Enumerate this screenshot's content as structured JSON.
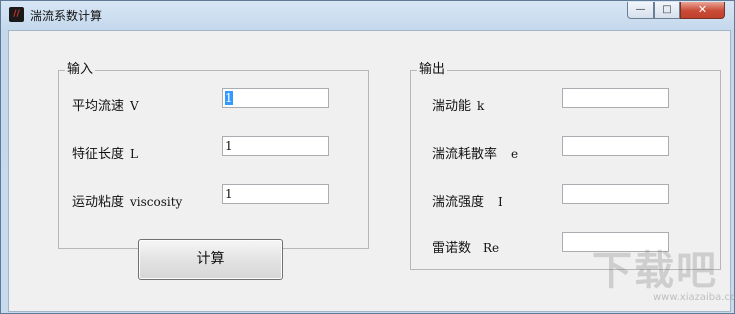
{
  "window": {
    "title": "湍流系数计算",
    "icon": "app-icon",
    "controls": {
      "minimize": "—",
      "maximize": "□",
      "close": "✕"
    }
  },
  "input_group": {
    "title": "输入",
    "rows": [
      {
        "label": "平均流速",
        "symbol": "V",
        "value": "1"
      },
      {
        "label": "特征长度",
        "symbol": "L",
        "value": "1"
      },
      {
        "label": "运动粘度",
        "symbol": "viscosity",
        "value": "1"
      }
    ]
  },
  "output_group": {
    "title": "输出",
    "rows": [
      {
        "label": "湍动能",
        "symbol": "k",
        "value": ""
      },
      {
        "label": "湍流耗散率",
        "symbol": "e",
        "value": ""
      },
      {
        "label": "湍流强度",
        "symbol": "I",
        "value": ""
      },
      {
        "label": "雷诺数",
        "symbol": "Re",
        "value": ""
      }
    ]
  },
  "calculate_button": {
    "label": "计算"
  },
  "watermark": {
    "text": "下载吧",
    "url": "www.xiazaiba.com"
  }
}
